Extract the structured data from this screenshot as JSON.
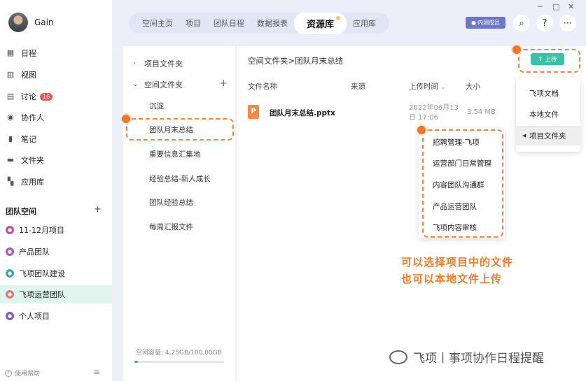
{
  "user": {
    "name": "Gain"
  },
  "nav": [
    {
      "icon": "calendar-icon",
      "glyph": "▦",
      "label": "日程"
    },
    {
      "icon": "view-icon",
      "glyph": "▥",
      "label": "视图"
    },
    {
      "icon": "discussion-icon",
      "glyph": "▤",
      "label": "讨论",
      "badge": "16"
    },
    {
      "icon": "collaborator-icon",
      "glyph": "◉",
      "label": "协作人"
    },
    {
      "icon": "note-icon",
      "glyph": "▮",
      "label": "笔记"
    },
    {
      "icon": "folder-icon",
      "glyph": "▬",
      "label": "文件夹"
    },
    {
      "icon": "app-library-icon",
      "glyph": "▚",
      "label": "应用库"
    }
  ],
  "team_space": {
    "title": "团队空间",
    "add": "+",
    "items": [
      {
        "label": "11-12月项目",
        "color": "#c4559a"
      },
      {
        "label": "产品团队",
        "color": "#b05ab0"
      },
      {
        "label": "飞项团队建设",
        "color": "#3aa7b8"
      },
      {
        "label": "飞项运营团队",
        "color": "#e6776f"
      },
      {
        "label": "个人项目",
        "color": "#8a56c2"
      }
    ]
  },
  "help": "使用帮助",
  "tabs": [
    "空间主页",
    "项目",
    "团队日程",
    "数据报表",
    "资源库",
    "应用库"
  ],
  "active_tab": "资源库",
  "member_button": "内测成员",
  "window_controls": {
    "minimize": "─",
    "maximize": "□",
    "close": "✕"
  },
  "topbar_icons": {
    "search": "⌕",
    "help": "?",
    "more": "⋯"
  },
  "tree": {
    "project_folder": "项目文件夹",
    "space_folder": "空间文件夹",
    "add": "+",
    "items": [
      "沉淀",
      "团队月末总结",
      "重要信息汇集地",
      "经验总结-新人成长",
      "团队经验总结",
      "每周汇报文件"
    ],
    "capacity": "空间容量: 4.25GB/100.00GB",
    "capacity_used_fraction": 0.0425
  },
  "main": {
    "breadcrumb": "空间文件夹>团队月末总结",
    "upload_label": "上传",
    "columns": {
      "name": "文件名称",
      "source": "来源",
      "uploaded": "上传时间",
      "size": "大小"
    },
    "files": [
      {
        "icon": "P",
        "name": "团队月末总结.pptx",
        "date": "2022年06月13日 17:06",
        "size": "3.54 MB"
      }
    ]
  },
  "upload_menu": {
    "items": [
      "飞项文档",
      "本地文件",
      "项目文件夹"
    ],
    "selected": "项目文件夹"
  },
  "project_submenu": [
    "招聘管理-飞项",
    "运营部门日常管理",
    "内容团队沟通群",
    "产品运营团队",
    "飞项内容审核"
  ],
  "annotation": [
    "可以选择项目中的文件",
    "也可以本地文件上传"
  ],
  "watermark": "飞项丨事项协作日程提醒",
  "colors": {
    "accent": "#3bc1a5",
    "annotation": "#f0863a",
    "member": "#6f76c9"
  }
}
